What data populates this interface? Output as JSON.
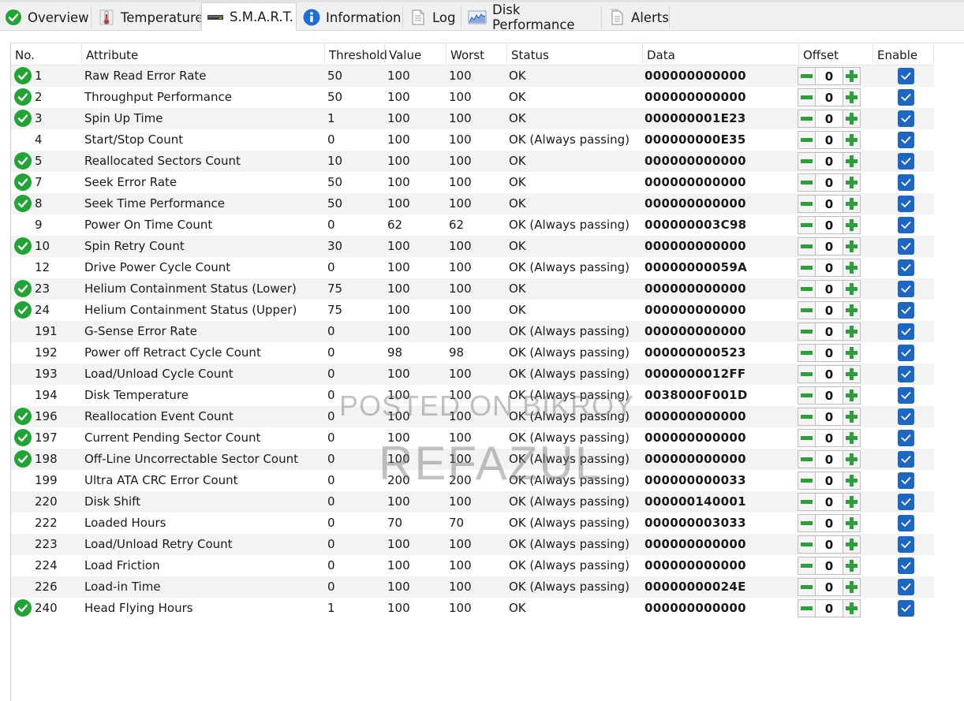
{
  "tabs": [
    {
      "label": "Overview",
      "icon": "check-circle-icon",
      "active": false
    },
    {
      "label": "Temperature",
      "icon": "thermometer-icon",
      "active": false
    },
    {
      "label": "S.M.A.R.T.",
      "icon": "drive-icon",
      "active": true
    },
    {
      "label": "Information",
      "icon": "info-icon",
      "active": false
    },
    {
      "label": "Log",
      "icon": "document-icon",
      "active": false
    },
    {
      "label": "Disk Performance",
      "icon": "performance-chart-icon",
      "active": false
    },
    {
      "label": "Alerts",
      "icon": "alerts-document-icon",
      "active": false
    }
  ],
  "columns": {
    "no": "No.",
    "attribute": "Attribute",
    "threshold": "Threshold",
    "value": "Value",
    "worst": "Worst",
    "status": "Status",
    "data": "Data",
    "offset": "Offset",
    "enable": "Enable"
  },
  "rows": [
    {
      "no": "1",
      "ok_icon": true,
      "attribute": "Raw Read Error Rate",
      "threshold": "50",
      "value": "100",
      "worst": "100",
      "status": "OK",
      "data": "000000000000",
      "offset": "0",
      "enabled": true
    },
    {
      "no": "2",
      "ok_icon": true,
      "attribute": "Throughput Performance",
      "threshold": "50",
      "value": "100",
      "worst": "100",
      "status": "OK",
      "data": "000000000000",
      "offset": "0",
      "enabled": true
    },
    {
      "no": "3",
      "ok_icon": true,
      "attribute": "Spin Up Time",
      "threshold": "1",
      "value": "100",
      "worst": "100",
      "status": "OK",
      "data": "000000001E23",
      "offset": "0",
      "enabled": true
    },
    {
      "no": "4",
      "ok_icon": false,
      "attribute": "Start/Stop Count",
      "threshold": "0",
      "value": "100",
      "worst": "100",
      "status": "OK (Always passing)",
      "data": "000000000E35",
      "offset": "0",
      "enabled": true
    },
    {
      "no": "5",
      "ok_icon": true,
      "attribute": "Reallocated Sectors Count",
      "threshold": "10",
      "value": "100",
      "worst": "100",
      "status": "OK",
      "data": "000000000000",
      "offset": "0",
      "enabled": true
    },
    {
      "no": "7",
      "ok_icon": true,
      "attribute": "Seek Error Rate",
      "threshold": "50",
      "value": "100",
      "worst": "100",
      "status": "OK",
      "data": "000000000000",
      "offset": "0",
      "enabled": true
    },
    {
      "no": "8",
      "ok_icon": true,
      "attribute": "Seek Time Performance",
      "threshold": "50",
      "value": "100",
      "worst": "100",
      "status": "OK",
      "data": "000000000000",
      "offset": "0",
      "enabled": true
    },
    {
      "no": "9",
      "ok_icon": false,
      "attribute": "Power On Time Count",
      "threshold": "0",
      "value": "62",
      "worst": "62",
      "status": "OK (Always passing)",
      "data": "000000003C98",
      "offset": "0",
      "enabled": true
    },
    {
      "no": "10",
      "ok_icon": true,
      "attribute": "Spin Retry Count",
      "threshold": "30",
      "value": "100",
      "worst": "100",
      "status": "OK",
      "data": "000000000000",
      "offset": "0",
      "enabled": true
    },
    {
      "no": "12",
      "ok_icon": false,
      "attribute": "Drive Power Cycle Count",
      "threshold": "0",
      "value": "100",
      "worst": "100",
      "status": "OK (Always passing)",
      "data": "00000000059A",
      "offset": "0",
      "enabled": true
    },
    {
      "no": "23",
      "ok_icon": true,
      "attribute": "Helium Containment Status (Lower)",
      "threshold": "75",
      "value": "100",
      "worst": "100",
      "status": "OK",
      "data": "000000000000",
      "offset": "0",
      "enabled": true
    },
    {
      "no": "24",
      "ok_icon": true,
      "attribute": "Helium Containment Status (Upper)",
      "threshold": "75",
      "value": "100",
      "worst": "100",
      "status": "OK",
      "data": "000000000000",
      "offset": "0",
      "enabled": true
    },
    {
      "no": "191",
      "ok_icon": false,
      "attribute": "G-Sense Error Rate",
      "threshold": "0",
      "value": "100",
      "worst": "100",
      "status": "OK (Always passing)",
      "data": "000000000000",
      "offset": "0",
      "enabled": true
    },
    {
      "no": "192",
      "ok_icon": false,
      "attribute": "Power off Retract Cycle Count",
      "threshold": "0",
      "value": "98",
      "worst": "98",
      "status": "OK (Always passing)",
      "data": "000000000523",
      "offset": "0",
      "enabled": true
    },
    {
      "no": "193",
      "ok_icon": false,
      "attribute": "Load/Unload Cycle Count",
      "threshold": "0",
      "value": "100",
      "worst": "100",
      "status": "OK (Always passing)",
      "data": "0000000012FF",
      "offset": "0",
      "enabled": true
    },
    {
      "no": "194",
      "ok_icon": false,
      "attribute": "Disk Temperature",
      "threshold": "0",
      "value": "100",
      "worst": "100",
      "status": "OK (Always passing)",
      "data": "0038000F001D",
      "offset": "0",
      "enabled": true
    },
    {
      "no": "196",
      "ok_icon": true,
      "attribute": "Reallocation Event Count",
      "threshold": "0",
      "value": "100",
      "worst": "100",
      "status": "OK (Always passing)",
      "data": "000000000000",
      "offset": "0",
      "enabled": true
    },
    {
      "no": "197",
      "ok_icon": true,
      "attribute": "Current Pending Sector Count",
      "threshold": "0",
      "value": "100",
      "worst": "100",
      "status": "OK (Always passing)",
      "data": "000000000000",
      "offset": "0",
      "enabled": true
    },
    {
      "no": "198",
      "ok_icon": true,
      "attribute": "Off-Line Uncorrectable Sector Count",
      "threshold": "0",
      "value": "100",
      "worst": "100",
      "status": "OK (Always passing)",
      "data": "000000000000",
      "offset": "0",
      "enabled": true
    },
    {
      "no": "199",
      "ok_icon": false,
      "attribute": "Ultra ATA CRC Error Count",
      "threshold": "0",
      "value": "200",
      "worst": "200",
      "status": "OK (Always passing)",
      "data": "000000000033",
      "offset": "0",
      "enabled": true
    },
    {
      "no": "220",
      "ok_icon": false,
      "attribute": "Disk Shift",
      "threshold": "0",
      "value": "100",
      "worst": "100",
      "status": "OK (Always passing)",
      "data": "000000140001",
      "offset": "0",
      "enabled": true
    },
    {
      "no": "222",
      "ok_icon": false,
      "attribute": "Loaded Hours",
      "threshold": "0",
      "value": "70",
      "worst": "70",
      "status": "OK (Always passing)",
      "data": "000000003033",
      "offset": "0",
      "enabled": true
    },
    {
      "no": "223",
      "ok_icon": false,
      "attribute": "Load/Unload Retry Count",
      "threshold": "0",
      "value": "100",
      "worst": "100",
      "status": "OK (Always passing)",
      "data": "000000000000",
      "offset": "0",
      "enabled": true
    },
    {
      "no": "224",
      "ok_icon": false,
      "attribute": "Load Friction",
      "threshold": "0",
      "value": "100",
      "worst": "100",
      "status": "OK (Always passing)",
      "data": "000000000000",
      "offset": "0",
      "enabled": true
    },
    {
      "no": "226",
      "ok_icon": false,
      "attribute": "Load-in Time",
      "threshold": "0",
      "value": "100",
      "worst": "100",
      "status": "OK (Always passing)",
      "data": "00000000024E",
      "offset": "0",
      "enabled": true
    },
    {
      "no": "240",
      "ok_icon": true,
      "attribute": "Head Flying Hours",
      "threshold": "1",
      "value": "100",
      "worst": "100",
      "status": "OK",
      "data": "000000000000",
      "offset": "0",
      "enabled": true
    }
  ],
  "watermark": {
    "line1": "POSTED ON BIKROY",
    "line2": "REFAZUL"
  },
  "colors": {
    "ok_green": "#21a336",
    "stepper_green": "#2e9e3b",
    "checkbox_blue": "#1d66c2",
    "alt_row": "#f3f3f3"
  }
}
